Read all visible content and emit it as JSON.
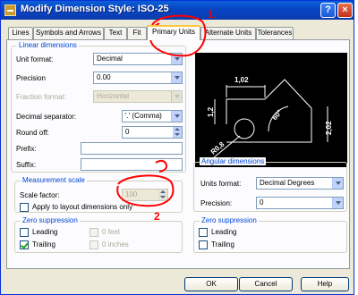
{
  "window": {
    "title": "Modify Dimension Style: ISO-25",
    "help_label": "?",
    "close_label": "×"
  },
  "tabs": [
    "Lines",
    "Symbols and Arrows",
    "Text",
    "Fit",
    "Primary Units",
    "Alternate Units",
    "Tolerances"
  ],
  "active_tab": "Primary Units",
  "linear": {
    "title": "Linear dimensions",
    "unit_format": {
      "label": "Unit format:",
      "value": "Decimal"
    },
    "precision": {
      "label": "Precision",
      "value": "0.00"
    },
    "fraction_format": {
      "label": "Fraction format:",
      "value": "Horizontal"
    },
    "decimal_separator": {
      "label": "Decimal separator:",
      "value": "'.' (Comma)"
    },
    "round_off": {
      "label": "Round off:",
      "value": "0"
    },
    "prefix": {
      "label": "Prefix:",
      "value": ""
    },
    "suffix": {
      "label": "Suffix:",
      "value": ""
    }
  },
  "measurement": {
    "title": "Measurement scale",
    "scale_factor": {
      "label": "Scale factor:",
      "value": "100"
    },
    "apply_layout": {
      "label": "Apply to layout dimensions only",
      "checked": false
    }
  },
  "zero_left": {
    "title": "Zero suppression",
    "leading": "Leading",
    "trailing": "Trailing",
    "feet": "0 feet",
    "inches": "0 inches"
  },
  "angular": {
    "title": "Angular dimensions",
    "units_format": {
      "label": "Units format:",
      "value": "Decimal Degrees"
    },
    "precision": {
      "label": "Precision:",
      "value": "0"
    }
  },
  "zero_right": {
    "title": "Zero suppression",
    "leading": "Leading",
    "trailing": "Trailing"
  },
  "preview": {
    "dims": [
      "1,02",
      "1,2",
      "2,02",
      "R0,8",
      "60°"
    ]
  },
  "annotations": [
    "1.",
    "2"
  ],
  "buttons": {
    "ok": "OK",
    "cancel": "Cancel",
    "help": "Help"
  },
  "colors": {
    "title_bar": "#0a5fd8",
    "group_title": "#0046d5",
    "annotation": "#ff0000",
    "preview_bg": "#000000"
  }
}
